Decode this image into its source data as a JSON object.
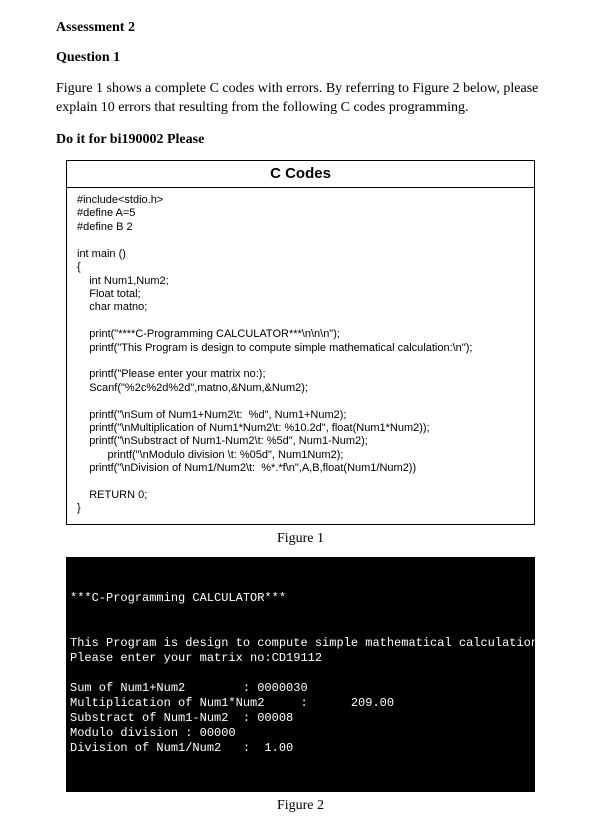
{
  "heading": "Assessment 2",
  "subheading": "Question 1",
  "para1": "Figure 1 shows a complete C codes with errors. By referring to Figure 2 below, please explain 10 errors that resulting from the following C codes programming.",
  "do_it": "Do it for bi190002 Please",
  "codebox": {
    "title": "C Codes",
    "code": "#include<stdio.h>\n#define A=5\n#define B 2\n\nint main ()\n{\n    int Num1,Num2;\n    Float total;\n    char matno;\n\n    print(\"****C-Programming CALCULATOR***\\n\\n\\n\");\n    printf(\"This Program is design to compute simple mathematical calculation:\\n\");\n\n    printf(\"Please enter your matrix no:);\n    Scanf(\"%2c%2d%2d\",matno,&Num,&Num2);\n\n    printf(\"\\nSum of Num1+Num2\\t:  %d\", Num1+Num2);\n    printf(\"\\nMultiplication of Num1*Num2\\t: %10.2d\", float(Num1*Num2));\n    printf(\"\\nSubstract of Num1-Num2\\t: %5d\", Num1-Num2);\n          printf(\"\\nModulo division \\t: %05d\", Num1Num2);\n    printf(\"\\nDivision of Num1/Num2\\t:  %*.*f\\n\",A,B,float(Num1/Num2))\n\n    RETURN 0;\n}"
  },
  "fig1": "Figure 1",
  "terminal_output": "***C-Programming CALCULATOR***\n\n\nThis Program is design to compute simple mathematical calculation:\nPlease enter your matrix no:CD19112\n\nSum of Num1+Num2        : 0000030\nMultiplication of Num1*Num2     :      209.00\nSubstract of Num1-Num2  : 00008\nModulo division : 00000\nDivision of Num1/Num2   :  1.00",
  "fig2": "Figure 2"
}
